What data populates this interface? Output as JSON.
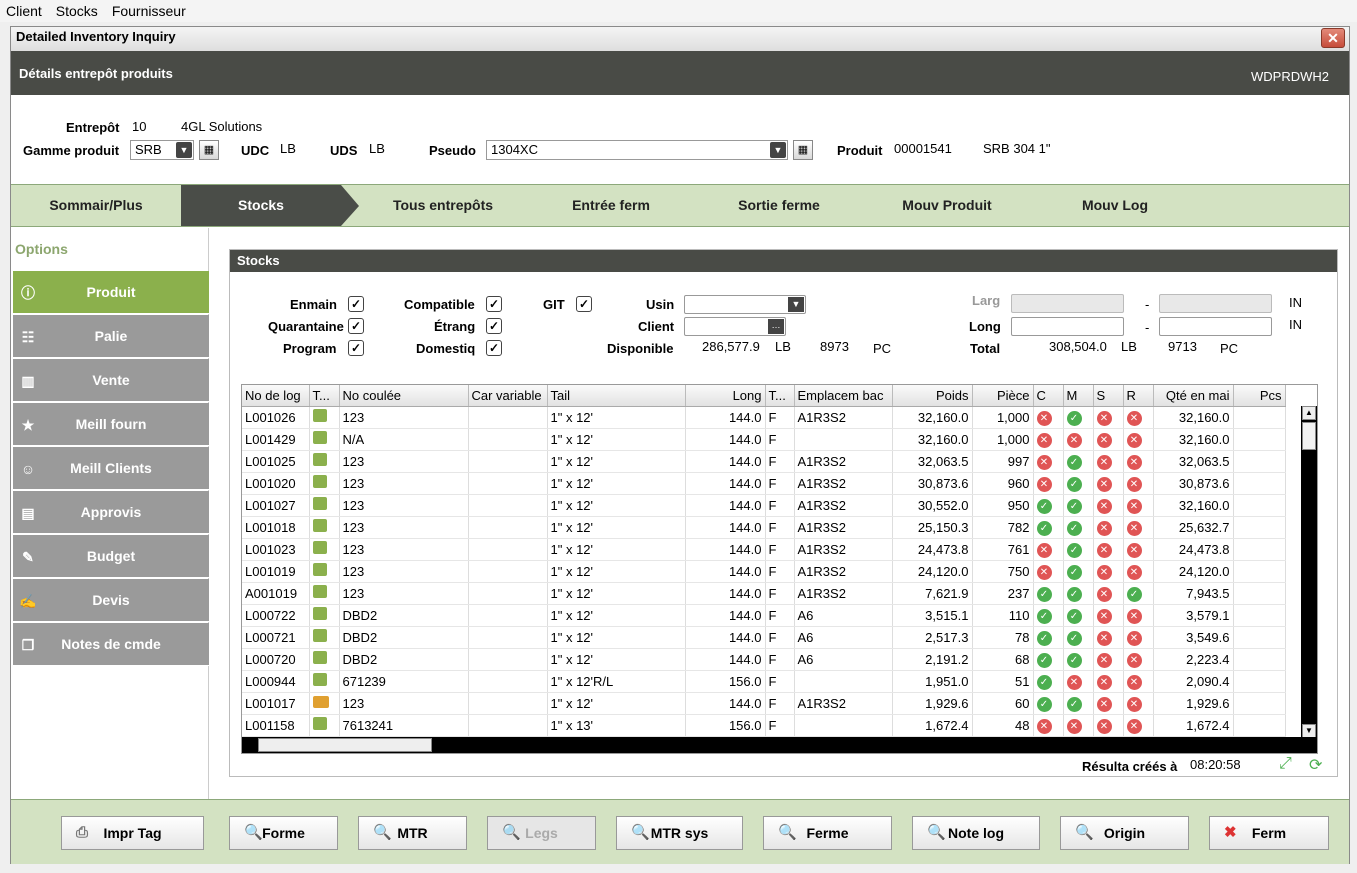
{
  "menu": [
    "Client",
    "Stocks",
    "Fournisseur"
  ],
  "window_title": "Detailed Inventory Inquiry",
  "close_symbol": "✕",
  "header": {
    "title": "Détails entrepôt produits",
    "code": "WDPRDWH2"
  },
  "info": {
    "entrepot_label": "Entrepôt",
    "entrepot_value": "10",
    "entrepot_name": "4GL Solutions",
    "gamme_label": "Gamme produit",
    "gamme_value": "SRB",
    "udc_label": "UDC",
    "udc_value": "LB",
    "uds_label": "UDS",
    "uds_value": "LB",
    "pseudo_label": "Pseudo",
    "pseudo_value": "1304XC",
    "produit_label": "Produit",
    "produit_code": "00001541",
    "produit_desc": "SRB 304 1\""
  },
  "tabs": [
    "Sommair/Plus",
    "Stocks",
    "Tous entrepôts",
    "Entrée ferm",
    "Sortie ferme",
    "Mouv Produit",
    "Mouv Log"
  ],
  "sidebar": {
    "title": "Options",
    "items": [
      "Produit",
      "Palie",
      "Vente",
      "Meill fourn",
      "Meill Clients",
      "Approvis",
      "Budget",
      "Devis",
      "Notes de cmde"
    ]
  },
  "panel": {
    "title": "Stocks",
    "checks": {
      "enmain": "Enmain",
      "quarantine": "Quarantaine",
      "program": "Program",
      "compatible": "Compatible",
      "etrang": "Étrang",
      "domestiq": "Domestiq",
      "git": "GIT"
    },
    "usin_label": "Usin",
    "client_label": "Client",
    "disponible_label": "Disponible",
    "disponible_value": "286,577.9",
    "disponible_unit": "LB",
    "disponible_pcs": "8973",
    "disponible_pcs_unit": "PC",
    "larg_label": "Larg",
    "long_label": "Long",
    "total_label": "Total",
    "total_value": "308,504.0",
    "total_unit": "LB",
    "total_pcs": "9713",
    "total_pcs_unit": "PC",
    "dash": "-",
    "unit_in": "IN",
    "result_label": "Résulta créés à",
    "result_time": "08:20:58"
  },
  "grid": {
    "headers": [
      "No de log",
      "T...",
      "No coulée",
      "Car variable",
      "Tail",
      "Long",
      "T...",
      "Emplacem bac",
      "Poids",
      "Pièce",
      "C",
      "M",
      "S",
      "R",
      "Qté en mai",
      "Pcs"
    ],
    "rows": [
      [
        "L001026",
        "t",
        "123",
        "",
        "1\" x 12'",
        "144.0",
        "F",
        "A1R3S2",
        "32,160.0",
        "1,000",
        "n",
        "o",
        "n",
        "n",
        "32,160.0"
      ],
      [
        "L001429",
        "t",
        "N/A",
        "",
        "1\" x 12'",
        "144.0",
        "F",
        "",
        "32,160.0",
        "1,000",
        "n",
        "n",
        "n",
        "n",
        "32,160.0"
      ],
      [
        "L001025",
        "t",
        "123",
        "",
        "1\" x 12'",
        "144.0",
        "F",
        "A1R3S2",
        "32,063.5",
        "997",
        "n",
        "o",
        "n",
        "n",
        "32,063.5"
      ],
      [
        "L001020",
        "t",
        "123",
        "",
        "1\" x 12'",
        "144.0",
        "F",
        "A1R3S2",
        "30,873.6",
        "960",
        "n",
        "o",
        "n",
        "n",
        "30,873.6"
      ],
      [
        "L001027",
        "t",
        "123",
        "",
        "1\" x 12'",
        "144.0",
        "F",
        "A1R3S2",
        "30,552.0",
        "950",
        "o",
        "o",
        "n",
        "n",
        "32,160.0"
      ],
      [
        "L001018",
        "t",
        "123",
        "",
        "1\" x 12'",
        "144.0",
        "F",
        "A1R3S2",
        "25,150.3",
        "782",
        "o",
        "o",
        "n",
        "n",
        "25,632.7"
      ],
      [
        "L001023",
        "t",
        "123",
        "",
        "1\" x 12'",
        "144.0",
        "F",
        "A1R3S2",
        "24,473.8",
        "761",
        "n",
        "o",
        "n",
        "n",
        "24,473.8"
      ],
      [
        "L001019",
        "t",
        "123",
        "",
        "1\" x 12'",
        "144.0",
        "F",
        "A1R3S2",
        "24,120.0",
        "750",
        "n",
        "o",
        "n",
        "n",
        "24,120.0"
      ],
      [
        "A001019",
        "t",
        "123",
        "",
        "1\" x 12'",
        "144.0",
        "F",
        "A1R3S2",
        "7,621.9",
        "237",
        "o",
        "o",
        "n",
        "o",
        "7,943.5"
      ],
      [
        "L000722",
        "t",
        "DBD2",
        "",
        "1\" x 12'",
        "144.0",
        "F",
        "A6",
        "3,515.1",
        "110",
        "o",
        "o",
        "n",
        "n",
        "3,579.1"
      ],
      [
        "L000721",
        "t",
        "DBD2",
        "",
        "1\" x 12'",
        "144.0",
        "F",
        "A6",
        "2,517.3",
        "78",
        "o",
        "o",
        "n",
        "n",
        "3,549.6"
      ],
      [
        "L000720",
        "t",
        "DBD2",
        "",
        "1\" x 12'",
        "144.0",
        "F",
        "A6",
        "2,191.2",
        "68",
        "o",
        "o",
        "n",
        "n",
        "2,223.4"
      ],
      [
        "L000944",
        "t",
        "671239",
        "",
        "1\" x 12'R/L",
        "156.0",
        "F",
        "",
        "1,951.0",
        "51",
        "o",
        "n",
        "n",
        "n",
        "2,090.4"
      ],
      [
        "L001017",
        "k",
        "123",
        "",
        "1\" x 12'",
        "144.0",
        "F",
        "A1R3S2",
        "1,929.6",
        "60",
        "o",
        "o",
        "n",
        "n",
        "1,929.6"
      ],
      [
        "L001158",
        "t",
        "7613241",
        "",
        "1\" x 13'",
        "156.0",
        "F",
        "",
        "1,672.4",
        "48",
        "n",
        "n",
        "n",
        "n",
        "1,672.4"
      ]
    ]
  },
  "buttons": [
    "Impr Tag",
    "Forme",
    "MTR",
    "Legs",
    "MTR sys",
    "Ferme",
    "Note log",
    "Origin",
    "Ferm"
  ]
}
